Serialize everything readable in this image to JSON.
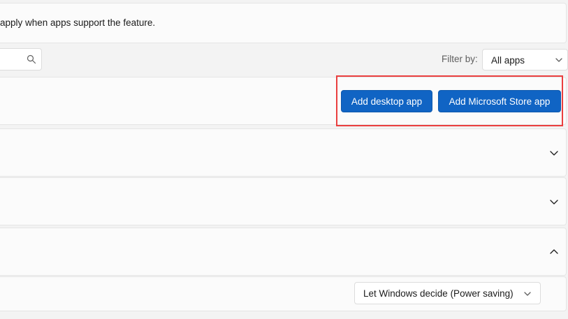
{
  "info": {
    "text": "apply when apps support the feature."
  },
  "toolbar": {
    "search_value": "",
    "filter_label": "Filter by:",
    "filter_value": "All apps"
  },
  "actions": {
    "add_desktop_label": "Add desktop app",
    "add_store_label": "Add Microsoft Store app"
  },
  "rows": [
    {
      "expanded": false,
      "chevron_icon": "chevron-down-icon"
    },
    {
      "expanded": false,
      "chevron_icon": "chevron-down-icon"
    },
    {
      "expanded": true,
      "chevron_icon": "chevron-up-icon"
    }
  ],
  "gpu_preference": {
    "value": "Let Windows decide (Power saving)"
  },
  "colors": {
    "accent": "#1064c4",
    "highlight": "#ea3f3f",
    "background": "#f3f3f3",
    "card": "#fbfbfb"
  }
}
